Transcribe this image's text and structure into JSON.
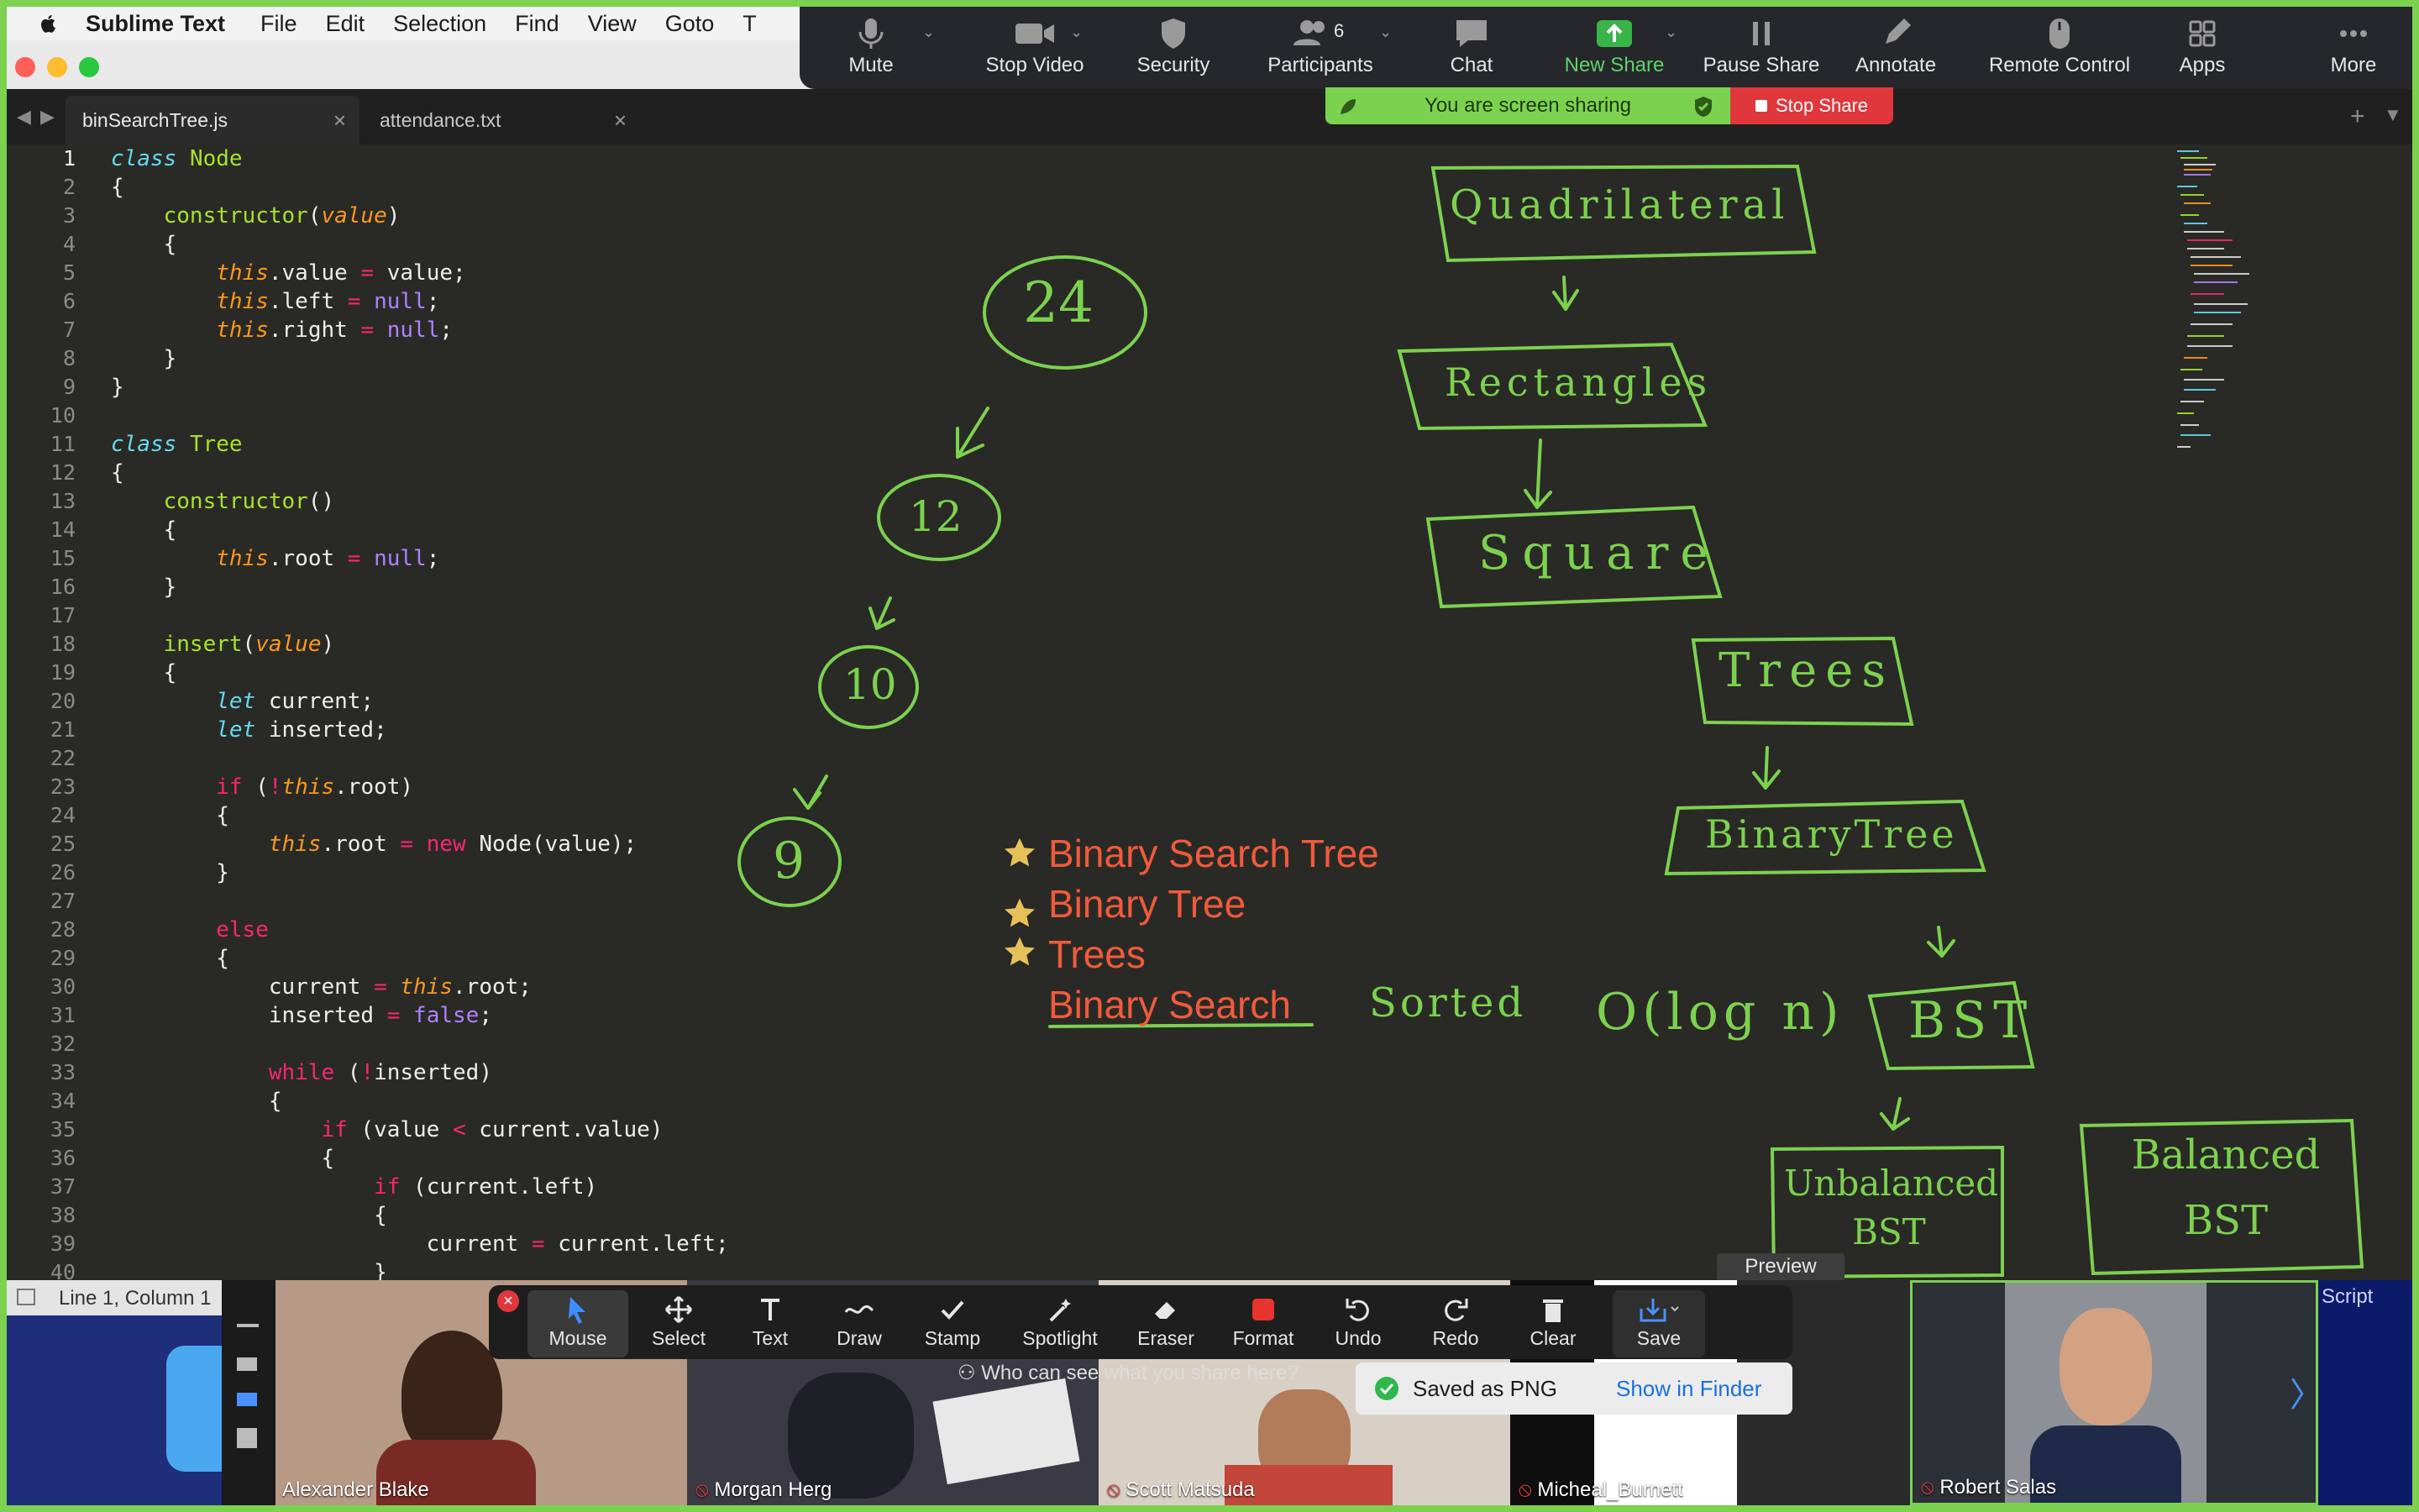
{
  "menubar": {
    "app_name": "Sublime Text",
    "items": [
      "File",
      "Edit",
      "Selection",
      "Find",
      "View",
      "Goto",
      "T"
    ]
  },
  "tabs": [
    {
      "label": "binSearchTree.js",
      "active": true
    },
    {
      "label": "attendance.txt",
      "active": false
    }
  ],
  "editor": {
    "line_numbers": [
      "1",
      "2",
      "3",
      "4",
      "5",
      "6",
      "7",
      "8",
      "9",
      "10",
      "11",
      "12",
      "13",
      "14",
      "15",
      "16",
      "17",
      "18",
      "19",
      "20",
      "21",
      "22",
      "23",
      "24",
      "25",
      "26",
      "27",
      "28",
      "29",
      "30",
      "31",
      "32",
      "33",
      "34",
      "35",
      "36",
      "37",
      "38",
      "39",
      "40"
    ],
    "status": "Line 1, Column 1"
  },
  "zoom_toolbar": {
    "mute": "Mute",
    "stop_video": "Stop Video",
    "security": "Security",
    "participants": "Participants",
    "participant_count": "6",
    "chat": "Chat",
    "new_share": "New Share",
    "pause_share": "Pause Share",
    "annotate": "Annotate",
    "remote_control": "Remote Control",
    "apps": "Apps",
    "more": "More"
  },
  "sharing": {
    "status": "You are screen sharing",
    "stop": "Stop Share"
  },
  "whiteboard": {
    "tree_nodes": [
      "24",
      "12",
      "10",
      "9"
    ],
    "hierarchy_1": [
      "Quadrilateral",
      "Rectangles",
      "Square"
    ],
    "hierarchy_2": [
      "Trees",
      "BinaryTree",
      "BST"
    ],
    "bst_children": [
      "Unbalanced BST",
      "Balanced BST"
    ],
    "sorted_note": "Sorted",
    "complexity": "O(log n)",
    "typed_notes": [
      "Binary Search Tree",
      "Binary Tree",
      "Trees",
      "Binary Search"
    ]
  },
  "annotation_toolbar": {
    "tools": [
      "Mouse",
      "Select",
      "Text",
      "Draw",
      "Stamp",
      "Spotlight",
      "Eraser",
      "Format",
      "Undo",
      "Redo",
      "Clear",
      "Save"
    ],
    "selected": "Mouse",
    "format_color": "#e8332f",
    "who_can_see": "Who can see what you share here?"
  },
  "save_toast": {
    "message": "Saved as PNG",
    "action": "Show in Finder"
  },
  "preview_label": "Preview",
  "partial_script_label": "Script",
  "participants": [
    {
      "name": "Alexander Blake",
      "muted": false
    },
    {
      "name": "Morgan Herg",
      "muted": true
    },
    {
      "name": "Scott Matsuda",
      "muted": true
    },
    {
      "name": "Micheal_Burnett",
      "muted": true
    },
    {
      "name": "Robert Salas",
      "muted": true
    }
  ],
  "colors": {
    "share_border": "#7cd14f",
    "ink": "#7cd14f",
    "note_red": "#f05a3c",
    "star": "#e6c15a",
    "stop_red": "#e0373c"
  }
}
